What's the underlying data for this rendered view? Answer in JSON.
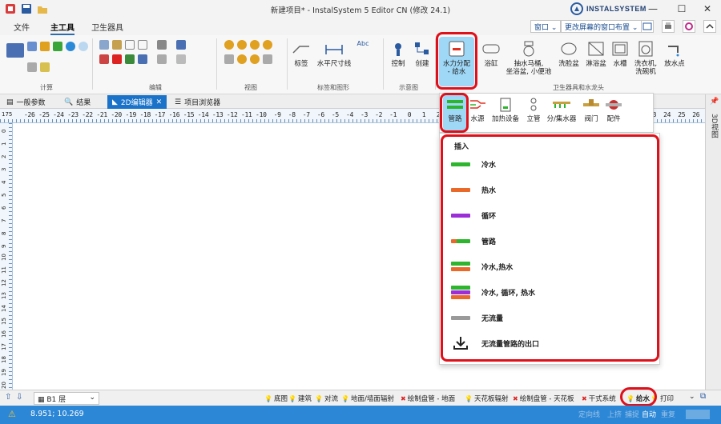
{
  "window": {
    "title": "新建项目* - InstalSystem 5 Editor CN (修改 24.1)",
    "brand": "INSTALSYSTEM",
    "controls": {
      "minimize": "—",
      "maximize": "☐",
      "close": "✕"
    }
  },
  "menu": {
    "tabs": [
      "文件",
      "主工具",
      "卫生器具"
    ],
    "active_tab": "主工具",
    "window_select": "窗口",
    "layout_select": "更改屏幕的窗口布置"
  },
  "ribbon": {
    "groups": [
      "计算",
      "编辑",
      "视图",
      "标签和图形",
      "示意图",
      "卫生器具和水龙头"
    ],
    "buttons": {
      "label": "标签",
      "horizontal_dim": "水平尺寸线",
      "abc": "Abc",
      "control": "控制",
      "create": "创建",
      "water_dist_line1": "水力分配",
      "water_dist_line2": "- 给水",
      "bathtub": "浴缸",
      "toilet_line1": "抽水马桶,",
      "toilet_line2": "坐浴盆, 小便池",
      "washbasin": "洗脸盆",
      "shower_tray": "淋浴盆",
      "sink": "水槽",
      "washer_line1": "洗衣机,",
      "washer_line2": "洗碗机",
      "drain_point": "放水点"
    }
  },
  "flyout_strip": {
    "items": [
      "管路",
      "水源",
      "加热设备",
      "立管",
      "分/集水器",
      "阀门",
      "配件"
    ]
  },
  "flyout_menu": {
    "header": "插入",
    "items": [
      {
        "label": "冷水",
        "kind": "cold"
      },
      {
        "label": "热水",
        "kind": "hot"
      },
      {
        "label": "循环",
        "kind": "circ"
      },
      {
        "label": "管路",
        "kind": "pipe"
      },
      {
        "label": "冷水,热水",
        "kind": "cold-hot"
      },
      {
        "label": "冷水, 循环, 热水",
        "kind": "cold-circ-hot"
      },
      {
        "label": "无流量",
        "kind": "noflow"
      },
      {
        "label": "无流量管路的出口",
        "kind": "outlet"
      }
    ]
  },
  "doc_tabs": {
    "general": "一般参数",
    "results": "结果",
    "editor2d": "2D编辑器",
    "browser": "项目浏览器"
  },
  "side_panel": {
    "label": "3D视图"
  },
  "ruler": {
    "h_corner": "175",
    "h_numbers": "-26 -25 -24 -23 -22 -21 -20 -19 -18 -17 -16 -15 -14 -13 -12 -11 -10  -9  -8  -7  -6  -5  -4  -3  -2  -1   0   1   2   3   4   5   6",
    "h_numbers_right": "22  23  24  25  26",
    "v_numbers": [
      "0",
      "1",
      "2",
      "3",
      "4",
      "5",
      "6",
      "7",
      "8",
      "9",
      "10",
      "11",
      "12",
      "13",
      "14",
      "15",
      "16",
      "17",
      "18",
      "19",
      "20"
    ]
  },
  "bottom": {
    "layer": "B1 层",
    "tabs": [
      "底图",
      "建筑",
      "对流",
      "地面/墙面辐射",
      "绘制盘管 - 地面",
      "天花板辐射",
      "绘制盘管 - 天花板",
      "干式系统",
      "给水",
      "打印"
    ],
    "active_tab": "给水"
  },
  "status": {
    "coords": "8.951; 10.269",
    "buttons": [
      "定向线",
      "上挤",
      "捕捉",
      "自动",
      "重复"
    ]
  },
  "colors": {
    "accent": "#1a73c9",
    "highlight": "#e0101a",
    "cold": "#2db52d",
    "hot": "#e8692a",
    "circ": "#9b2ed6",
    "noflow": "#9a9a9a"
  }
}
